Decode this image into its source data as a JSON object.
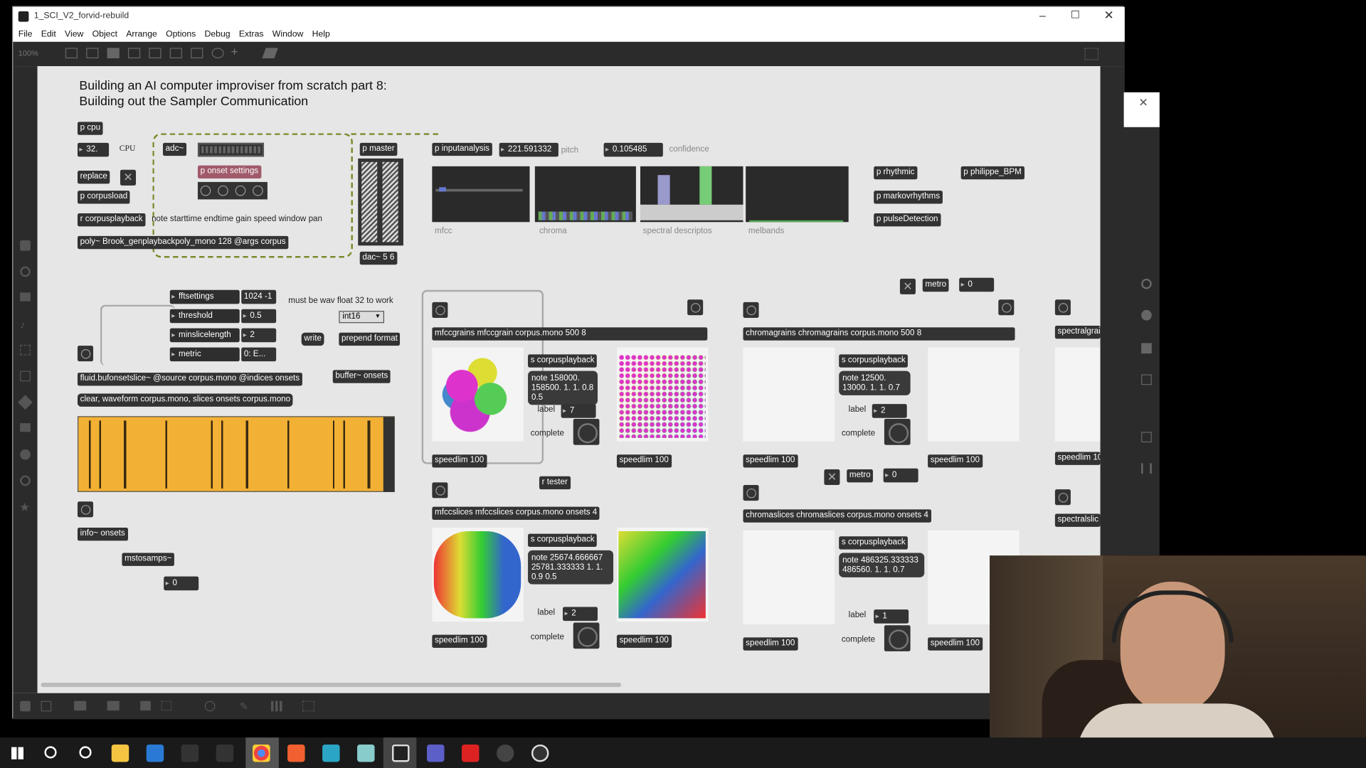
{
  "window": {
    "title": "1_SCI_V2_forvid-rebuild"
  },
  "menu": [
    "File",
    "Edit",
    "View",
    "Object",
    "Arrange",
    "Options",
    "Debug",
    "Extras",
    "Window",
    "Help"
  ],
  "toolbar": {
    "zoom": "100%"
  },
  "patch": {
    "title_line1": "Building an AI computer improviser from scratch part 8:",
    "title_line2": "Building out the Sampler Communication",
    "p_cpu": "p cpu",
    "cpu_value": "32.",
    "cpu_label": "CPU",
    "adc": "adc~",
    "replace": "replace",
    "p_corpusload": "p corpusload",
    "p_onset_settings": "p onset settings",
    "r_corpusplayback": "r corpusplayback",
    "playback_comment": "note starttime endtime gain speed window pan",
    "poly": "poly~ Brook_genplaybackpoly_mono 128 @args corpus",
    "p_master": "p master",
    "dac": "dac~ 5 6",
    "p_inputanalysis": "p inputanalysis",
    "pitch_value": "221.591332",
    "pitch_label": "pitch",
    "confidence_value": "0.105485",
    "confidence_label": "confidence",
    "analysis_labels": [
      "mfcc",
      "chroma",
      "spectral descriptos",
      "melbands"
    ],
    "p_rhythmic": "p rhythmic",
    "p_philippe": "p philippe_BPM",
    "p_markov": "p markovrhythms",
    "p_pulse": "p pulseDetection",
    "settings": [
      {
        "label": "fftsettings",
        "value": "1024 -1"
      },
      {
        "label": "threshold",
        "value": "0.5"
      },
      {
        "label": "minslicelength",
        "value": "2"
      },
      {
        "label": "metric",
        "value": "0: E..."
      }
    ],
    "wav_comment": "must be wav float 32 to work",
    "int16": "int16",
    "write": "write",
    "prepend_format": "prepend format",
    "buffer_onsets": "buffer~ onsets",
    "bufonset": "fluid.bufonsetslice~ @source corpus.mono @indices onsets",
    "clear_msg": "clear, waveform corpus.mono, slices onsets corpus.mono",
    "info_onsets": "info~ onsets",
    "mstosamps": "mstosamps~",
    "zero": "0",
    "r_tester": "r tester",
    "metro": "metro",
    "metro_value": "0",
    "metro2": "metro",
    "metro2_value": "0",
    "s_corpusplayback": "s corpusplayback",
    "label_text": "label",
    "complete_text": "complete",
    "speedlim": "speedlim 100",
    "modules": [
      {
        "header": "mfccgrains mfccgrain corpus.mono 500 8",
        "note": "note 158000. 158500. 1. 1. 0.8 0.5",
        "label_value": "7"
      },
      {
        "header": "chromagrains chromagrains corpus.mono 500 8",
        "note": "note 12500. 13000. 1. 1. 0.7",
        "label_value": "2"
      },
      {
        "header": "mfccslices mfccslices corpus.mono onsets 4",
        "note": "note 25674.666667 25781.333333 1. 1. 0.9 0.5",
        "label_value": "2"
      },
      {
        "header": "chromaslices chromaslices corpus.mono onsets 4",
        "note": "note 486325.333333 486560. 1. 1. 0.7",
        "label_value": "1"
      }
    ],
    "spectralgrains": "spectralgrai",
    "spectralslices": "spectralslic"
  },
  "colors": {
    "waveform": "#f2b134",
    "canvas": "#e6e6e6",
    "object": "#333333",
    "cable_green": "#7a8a2a"
  }
}
